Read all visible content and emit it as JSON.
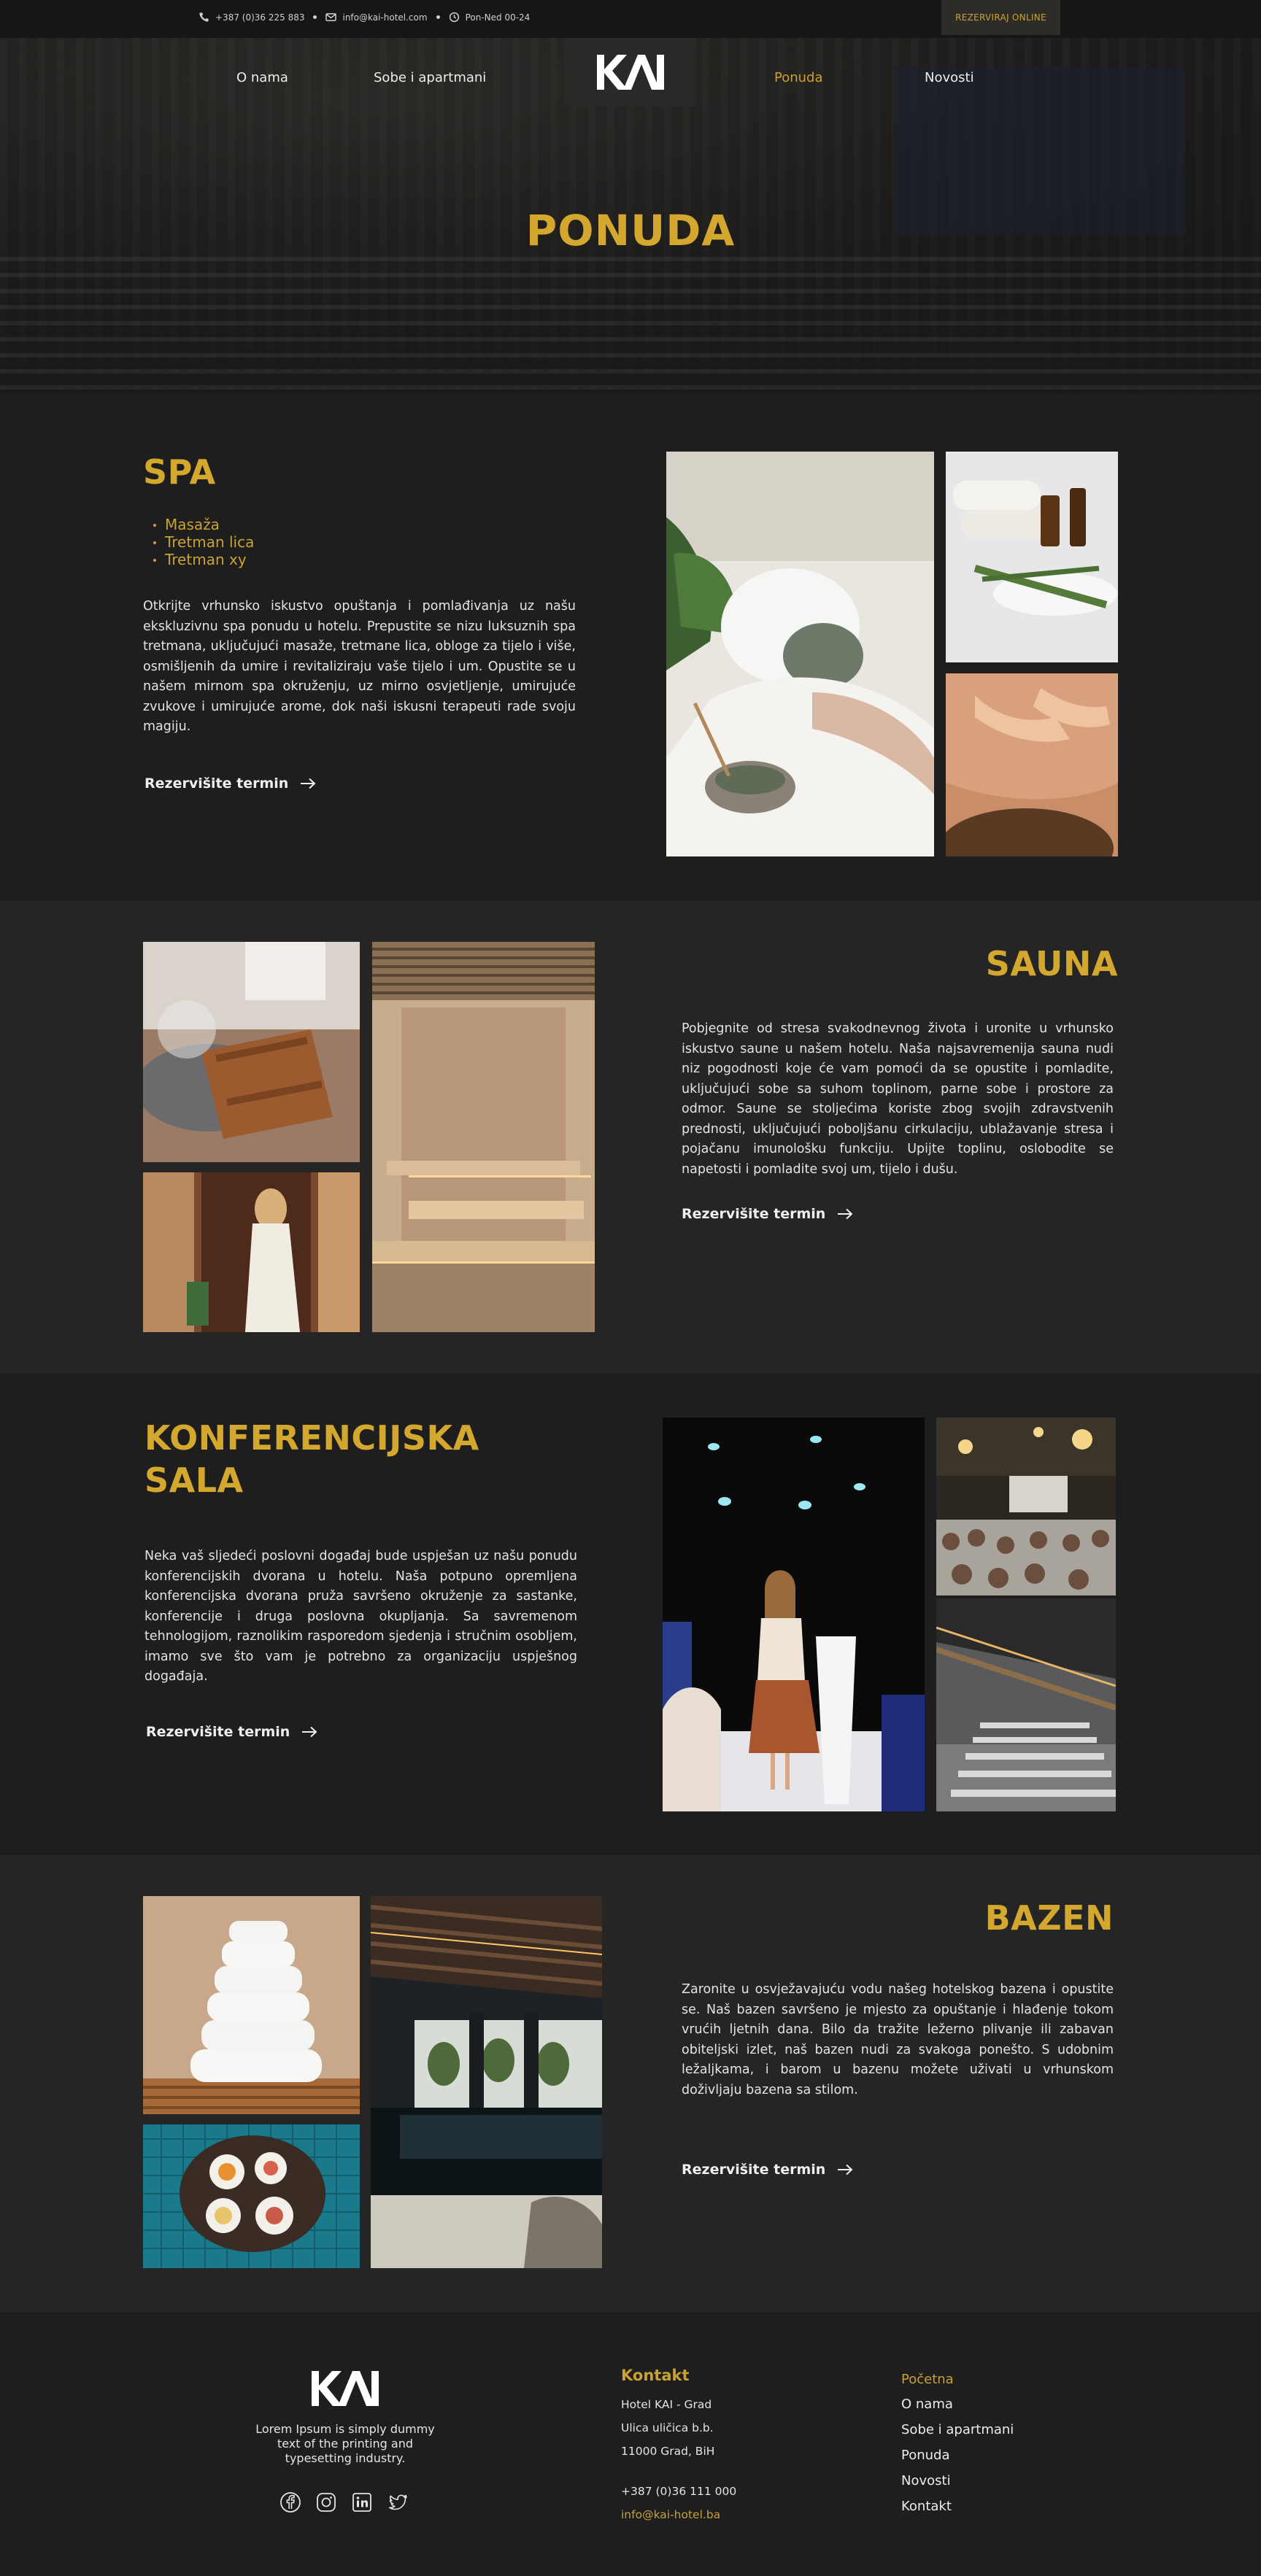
{
  "topbar": {
    "phone": "+387 (0)36 225 883",
    "email": "info@kai-hotel.com",
    "hours": "Pon-Ned 00-24",
    "reserve_button": "REZERVIRAJ ONLINE"
  },
  "nav": {
    "items": [
      "O nama",
      "Sobe i apartmani",
      "Ponuda",
      "Novosti"
    ],
    "active": "Ponuda",
    "logo": "KAI"
  },
  "hero": {
    "title": "PONUDA"
  },
  "spa": {
    "title": "SPA",
    "list": [
      "Masaža",
      "Tretman lica",
      "Tretman xy"
    ],
    "text": "Otkrijte vrhunsko iskustvo opuštanja i pomlađivanja uz našu ekskluzivnu spa ponudu u hotelu. Prepustite se nizu luksuznih spa tretmana, uključujući masaže, tretmane lica, obloge za tijelo i više, osmišljenih da umire i revitaliziraju vaše tijelo i um. Opustite se u našem mirnom spa okruženju, uz mirno osvjetljenje, umirujuće zvukove i umirujuće arome, dok naši iskusni terapeuti rade svoju magiju.",
    "cta": "Rezervišite termin"
  },
  "sauna": {
    "title": "SAUNA",
    "text": "Pobjegnite od stresa svakodnevnog života i uronite u vrhunsko iskustvo saune u našem hotelu. Naša najsavremenija sauna nudi niz pogodnosti koje će vam pomoći da se opustite i pomladite, uključujući sobe sa suhom toplinom, parne sobe i prostore za odmor. Saune se stoljećima koriste zbog svojih zdravstvenih prednosti, uključujući poboljšanu cirkulaciju, ublažavanje stresa i pojačanu imunološku funkciju. Upijte toplinu, oslobodite se napetosti i pomladite svoj um, tijelo i dušu.",
    "cta": "Rezervišite termin"
  },
  "konf": {
    "title_line1": "KONFERENCIJSKA",
    "title_line2": "SALA",
    "text": "Neka vaš sljedeći poslovni događaj bude uspješan uz našu ponudu konferencijskih dvorana u hotelu. Naša potpuno opremljena konferencijska dvorana pruža savršeno okruženje za sastanke, konferencije i druga poslovna okupljanja. Sa savremenom tehnologijom, raznolikim rasporedom sjedenja i stručnim osobljem, imamo sve što vam je potrebno za organizaciju uspješnog događaja.",
    "cta": "Rezervišite termin"
  },
  "bazen": {
    "title": "BAZEN",
    "text": "Zaronite u osvježavajuću vodu našeg hotelskog bazena i opustite se. Naš bazen savršeno je mjesto za opuštanje i hlađenje tokom vrućih ljetnih dana. Bilo da tražite ležerno plivanje ili zabavan obiteljski izlet, naš bazen nudi za svakoga ponešto. S udobnim ležaljkama, i barom u bazenu možete uživati u vrhunskom doživljaju bazena sa stilom.",
    "cta": "Rezervišite termin"
  },
  "footer": {
    "logo": "KAI",
    "tagline": "Lorem Ipsum is simply dummy text of the printing and typesetting industry.",
    "contact_heading": "Kontakt",
    "address_lines": [
      "Hotel KAI - Grad",
      "Ulica uličica b.b.",
      "11000 Grad, BiH"
    ],
    "phone": "+387 (0)36 111 000",
    "email": "info@kai-hotel.ba",
    "nav": [
      "Početna",
      "O nama",
      "Sobe i apartmani",
      "Ponuda",
      "Novosti",
      "Kontakt"
    ],
    "nav_active": "Početna",
    "social": [
      "facebook-icon",
      "instagram-icon",
      "linkedin-icon",
      "twitter-icon"
    ]
  },
  "colors": {
    "accent": "#d4a82f",
    "background": "#1e1e1e",
    "alt_background": "#252525",
    "text": "#e4e4e4"
  }
}
